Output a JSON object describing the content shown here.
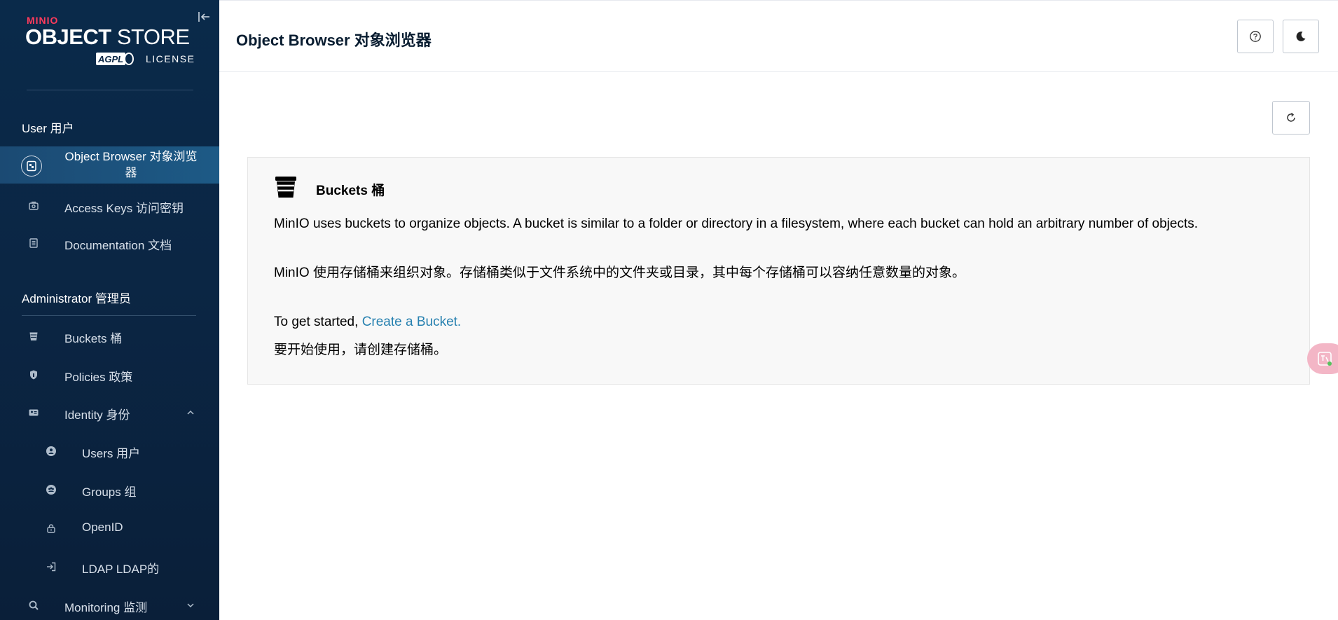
{
  "brand": {
    "small": "MINIO",
    "main_bold": "OBJECT",
    "main_thin": "STORE",
    "badge": "AGPL",
    "license": "LICENSE"
  },
  "sidebar": {
    "user_section": "User 用户",
    "admin_section": "Administrator 管理员",
    "user_items": [
      {
        "label": "Object Browser 对象浏览器",
        "icon": "object-browser-icon",
        "active": true
      },
      {
        "label": "Access Keys 访问密钥",
        "icon": "access-keys-icon"
      },
      {
        "label": "Documentation 文档",
        "icon": "documentation-icon"
      }
    ],
    "admin_items": [
      {
        "label": "Buckets 桶",
        "icon": "bucket-icon"
      },
      {
        "label": "Policies 政策",
        "icon": "policy-shield-icon"
      },
      {
        "label": "Identity 身份",
        "icon": "identity-card-icon",
        "expanded": true
      },
      {
        "label": "Users 用户",
        "icon": "user-icon"
      },
      {
        "label": "Groups 组",
        "icon": "groups-icon"
      },
      {
        "label": "OpenID",
        "icon": "openid-lock-icon"
      },
      {
        "label": "LDAP LDAP的",
        "icon": "ldap-login-icon"
      },
      {
        "label": "Monitoring 监测",
        "icon": "monitoring-search-icon",
        "expanded": false
      }
    ]
  },
  "header": {
    "title": "Object Browser 对象浏览器",
    "help_icon": "help-circle-icon",
    "theme_icon": "moon-icon"
  },
  "main": {
    "refresh_icon": "refresh-icon",
    "card": {
      "icon": "bucket-icon",
      "title": "Buckets 桶",
      "desc_en": "MinIO uses buckets to organize objects. A bucket is similar to a folder or directory in a filesystem, where each bucket can hold an arbitrary number of objects.",
      "desc_zh": "MinIO 使用存储桶来组织对象。存储桶类似于文件系统中的文件夹或目录，其中每个存储桶可以容纳任意数量的对象。",
      "start_prefix": "To get started, ",
      "start_link": "Create a Bucket.",
      "start_zh": "要开始使用，请创建存储桶。"
    }
  },
  "colors": {
    "sidebar_bg": "#0b2644",
    "active_item": "#1d5a86",
    "link": "#2781b0",
    "brand_red": "#ff3b5c"
  }
}
